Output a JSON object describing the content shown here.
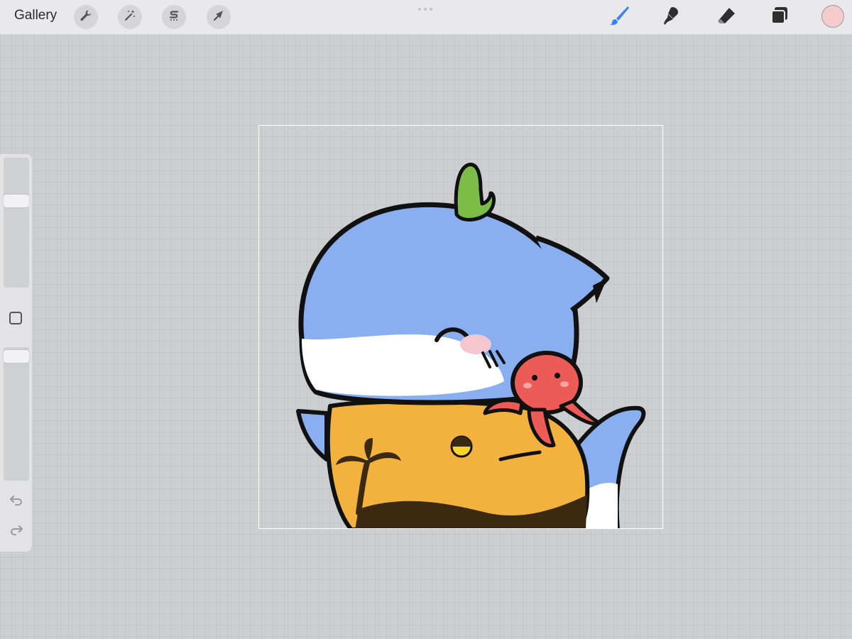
{
  "topbar": {
    "gallery_label": "Gallery",
    "left_tools": [
      "wrench-icon",
      "magic-wand-icon",
      "selection-s-icon",
      "arrow-transform-icon"
    ],
    "right_tools": [
      "brush-icon",
      "smudge-icon",
      "eraser-icon",
      "layers-icon"
    ],
    "active_tool": "brush-icon",
    "active_tool_color": "#3a82f7",
    "current_color": "#f5cbce"
  },
  "sidebar": {
    "brush_size_level": 0.28,
    "opacity_level": 0.06,
    "controls": [
      "brush-size-slider",
      "modify-button",
      "opacity-slider",
      "undo-icon",
      "redo-icon"
    ]
  },
  "colors": {
    "canvas_background": "#cdced1",
    "shark_blue": "#89aff0",
    "shirt_orange": "#f2b23d",
    "octopus_red": "#ec5b55",
    "cactus_green": "#7cbd48"
  }
}
